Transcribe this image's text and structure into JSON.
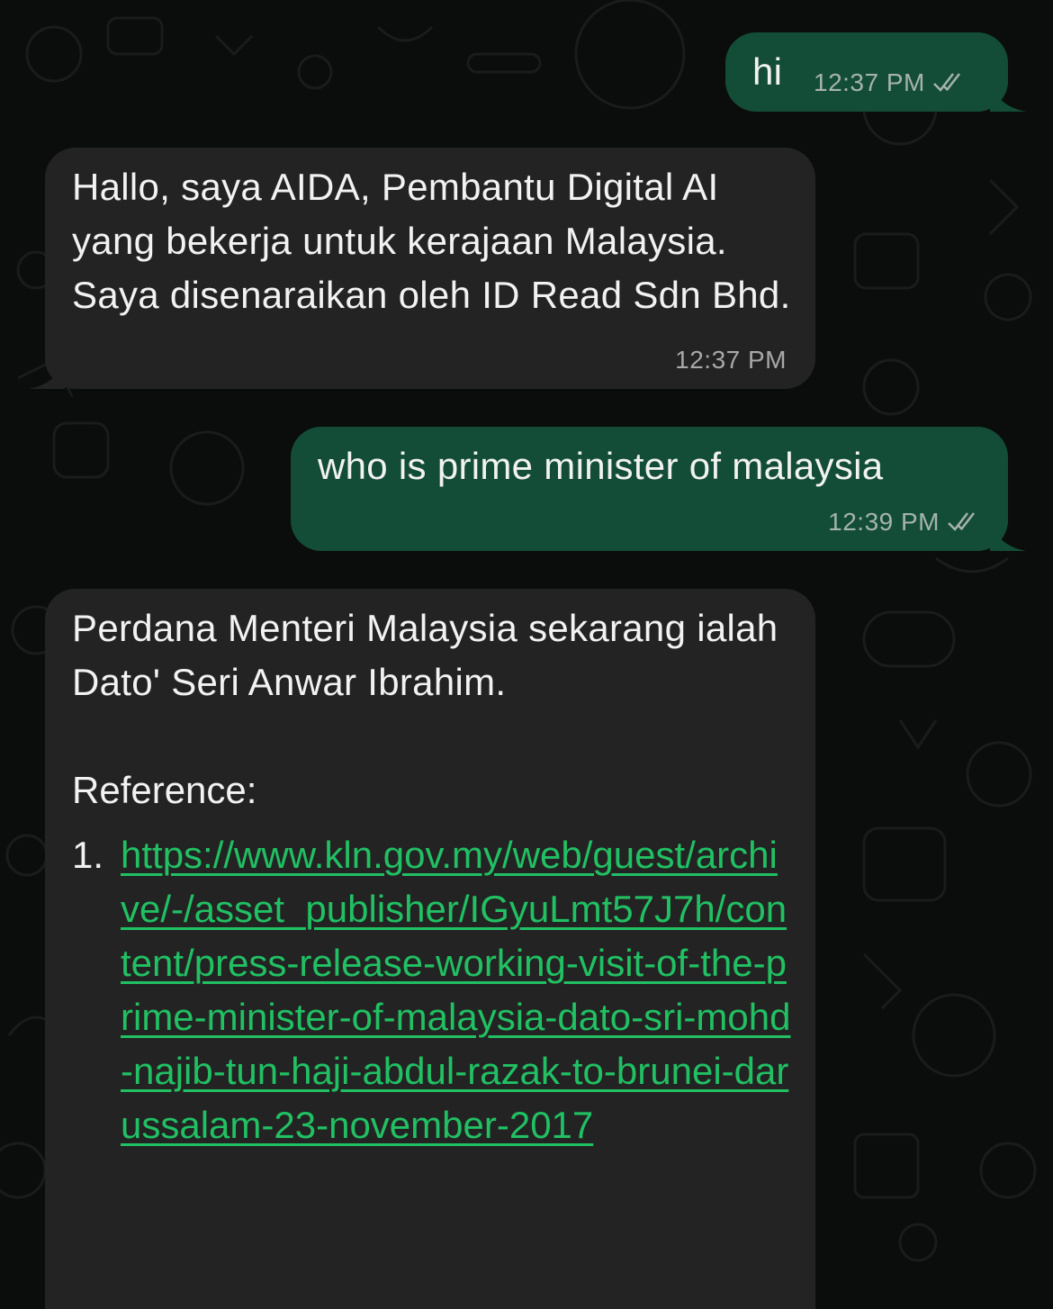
{
  "messages": [
    {
      "direction": "outgoing",
      "text": "hi",
      "time": "12:37 PM",
      "status_icon": "double-check-icon"
    },
    {
      "direction": "incoming",
      "text": "Hallo, saya AIDA, Pembantu Digital AI yang bekerja untuk kerajaan Malaysia. Saya disenaraikan oleh ID Read Sdn Bhd.",
      "time": "12:37 PM"
    },
    {
      "direction": "outgoing",
      "text": "who is prime minister of malaysia",
      "time": "12:39 PM",
      "status_icon": "double-check-icon"
    },
    {
      "direction": "incoming",
      "text": "Perdana Menteri Malaysia sekarang ialah Dato' Seri Anwar Ibrahim.",
      "reference_label": "Reference:",
      "references": [
        {
          "number": "1.",
          "url": "https://www.kln.gov.my/web/guest/archive/-/asset_publisher/IGyuLmt57J7h/content/press-release-working-visit-of-the-prime-minister-of-malaysia-dato-sri-mohd-najib-tun-haji-abdul-razak-to-brunei-darussalam-23-november-2017"
        }
      ]
    }
  ],
  "colors": {
    "background": "#0b0d0c",
    "outgoing_bubble": "#134d37",
    "incoming_bubble": "#232323",
    "link": "#21c063"
  }
}
